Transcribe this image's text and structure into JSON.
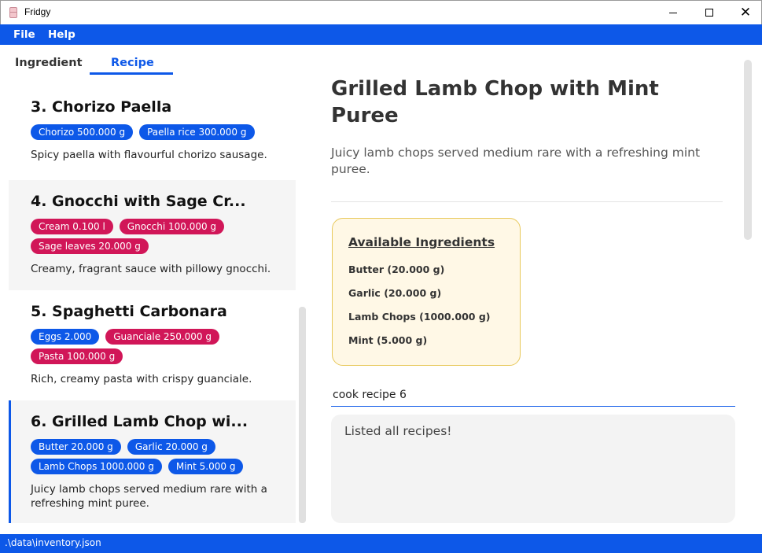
{
  "window": {
    "title": "Fridgy",
    "close_glyph": "✕"
  },
  "menu": {
    "file": "File",
    "help": "Help"
  },
  "tabs": {
    "ingredient": "Ingredient",
    "recipe": "Recipe",
    "active": "Recipe"
  },
  "recipes": [
    {
      "title": "3.  Chorizo Paella",
      "tags": [
        {
          "label": "Chorizo 500.000 g",
          "status": "available"
        },
        {
          "label": "Paella rice 300.000 g",
          "status": "available"
        }
      ],
      "description": "Spicy paella with flavourful chorizo sausage."
    },
    {
      "title": "4.  Gnocchi with Sage Cr...",
      "tags": [
        {
          "label": "Cream 0.100 l",
          "status": "missing"
        },
        {
          "label": "Gnocchi 100.000 g",
          "status": "missing"
        },
        {
          "label": "Sage leaves 20.000 g",
          "status": "missing"
        }
      ],
      "description": "Creamy, fragrant sauce with pillowy gnocchi."
    },
    {
      "title": "5.  Spaghetti Carbonara",
      "tags": [
        {
          "label": "Eggs 2.000",
          "status": "available"
        },
        {
          "label": "Guanciale 250.000 g",
          "status": "missing"
        },
        {
          "label": "Pasta 100.000 g",
          "status": "missing"
        }
      ],
      "description": "Rich, creamy pasta with crispy guanciale."
    },
    {
      "title": "6.  Grilled Lamb Chop wi...",
      "tags": [
        {
          "label": "Butter 20.000 g",
          "status": "available"
        },
        {
          "label": "Garlic 20.000 g",
          "status": "available"
        },
        {
          "label": "Lamb Chops 1000.000 g",
          "status": "available"
        },
        {
          "label": "Mint 5.000 g",
          "status": "available"
        }
      ],
      "description": "Juicy lamb chops served medium rare with a refreshing mint puree."
    }
  ],
  "detail": {
    "title": "Grilled Lamb Chop with Mint Puree",
    "description": "Juicy lamb chops served medium rare with a refreshing mint puree.",
    "ingredients_heading": "Available Ingredients",
    "ingredients": [
      "Butter (20.000 g)",
      "Garlic (20.000 g)",
      "Lamb Chops (1000.000 g)",
      "Mint (5.000 g)"
    ]
  },
  "command": {
    "value": "cook recipe 6"
  },
  "result": {
    "message": "Listed all recipes!"
  },
  "status": {
    "path": ".\\data\\inventory.json"
  },
  "colors": {
    "accent": "#0d58e8",
    "available_tag": "#0d58e8",
    "missing_tag": "#d11658",
    "ingredient_box_bg": "#fff8e6",
    "ingredient_box_border": "#e8c85a"
  }
}
